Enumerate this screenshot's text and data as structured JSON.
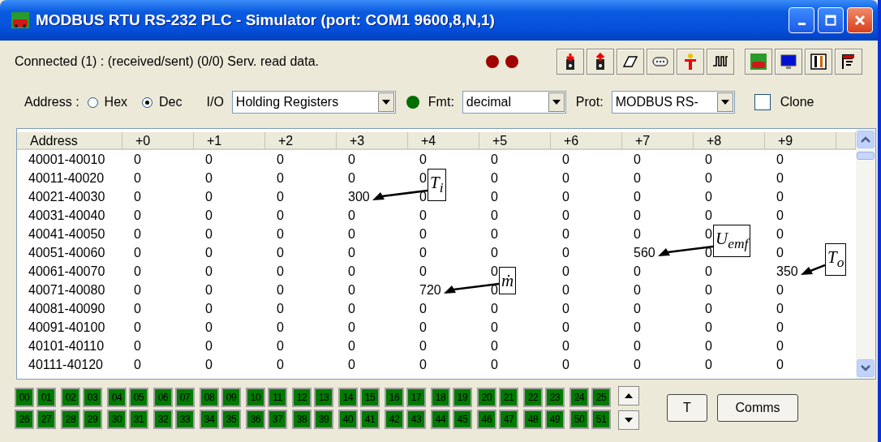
{
  "window": {
    "title": "MODBUS RTU RS-232 PLC - Simulator (port: COM1 9600,8,N,1)"
  },
  "status": {
    "text": "Connected (1) : (received/sent) (0/0) Serv. read data."
  },
  "address": {
    "label": "Address :",
    "options": [
      {
        "label": "Hex",
        "selected": false
      },
      {
        "label": "Dec",
        "selected": true
      }
    ]
  },
  "io": {
    "label": "I/O",
    "value": "Holding Registers"
  },
  "fmt": {
    "label": "Fmt:",
    "value": "decimal"
  },
  "prot": {
    "label": "Prot:",
    "value": "MODBUS RS-"
  },
  "clone": {
    "label": "Clone",
    "checked": false
  },
  "table": {
    "columns": [
      "Address",
      "+0",
      "+1",
      "+2",
      "+3",
      "+4",
      "+5",
      "+6",
      "+7",
      "+8",
      "+9"
    ],
    "rows": [
      {
        "address": "40001-40010",
        "values": [
          "0",
          "0",
          "0",
          "0",
          "0",
          "0",
          "0",
          "0",
          "0",
          "0"
        ]
      },
      {
        "address": "40011-40020",
        "values": [
          "0",
          "0",
          "0",
          "0",
          "0",
          "0",
          "0",
          "0",
          "0",
          "0"
        ]
      },
      {
        "address": "40021-40030",
        "values": [
          "0",
          "0",
          "0",
          {
            "value": "300",
            "callout": "T$_{i}$"
          },
          "0",
          "0",
          "0",
          "0",
          "0",
          "0"
        ]
      },
      {
        "address": "40031-40040",
        "values": [
          "0",
          "0",
          "0",
          "0",
          "0",
          "0",
          "0",
          "0",
          "0",
          "0"
        ]
      },
      {
        "address": "40041-40050",
        "values": [
          "0",
          "0",
          "0",
          "0",
          "0",
          "0",
          "0",
          "0",
          "0",
          "0"
        ]
      },
      {
        "address": "40051-40060",
        "values": [
          "0",
          "0",
          "0",
          "0",
          "0",
          "0",
          "0",
          {
            "value": "560",
            "callout": "U$_{emf}$"
          },
          "0",
          "0"
        ]
      },
      {
        "address": "40061-40070",
        "values": [
          "0",
          "0",
          "0",
          "0",
          "0",
          "0",
          "0",
          "0",
          "0",
          {
            "value": "350",
            "callout": "T$_{o}$"
          }
        ]
      },
      {
        "address": "40071-40080",
        "values": [
          "0",
          "0",
          "0",
          "0",
          {
            "value": "720",
            "callout": "ṁ"
          },
          "0",
          "0",
          "0",
          "0",
          "0"
        ]
      },
      {
        "address": "40081-40090",
        "values": [
          "0",
          "0",
          "0",
          "0",
          "0",
          "0",
          "0",
          "0",
          "0",
          "0"
        ]
      },
      {
        "address": "40091-40100",
        "values": [
          "0",
          "0",
          "0",
          "0",
          "0",
          "0",
          "0",
          "0",
          "0",
          "0"
        ]
      },
      {
        "address": "40101-40110",
        "values": [
          "0",
          "0",
          "0",
          "0",
          "0",
          "0",
          "0",
          "0",
          "0",
          "0"
        ]
      },
      {
        "address": "40111-40120",
        "values": [
          "0",
          "0",
          "0",
          "0",
          "0",
          "0",
          "0",
          "0",
          "0",
          "0"
        ]
      }
    ]
  },
  "slaves": [
    "00",
    "01",
    "02",
    "03",
    "04",
    "05",
    "06",
    "07",
    "08",
    "09",
    "10",
    "11",
    "12",
    "13",
    "14",
    "15",
    "16",
    "17",
    "18",
    "19",
    "20",
    "21",
    "22",
    "23",
    "24",
    "25",
    "26",
    "27",
    "28",
    "29",
    "30",
    "31",
    "32",
    "33",
    "34",
    "35",
    "36",
    "37",
    "38",
    "39",
    "40",
    "41",
    "42",
    "43",
    "44",
    "45",
    "46",
    "47",
    "48",
    "49",
    "50",
    "51"
  ],
  "buttons": [
    "T",
    "Comms"
  ]
}
